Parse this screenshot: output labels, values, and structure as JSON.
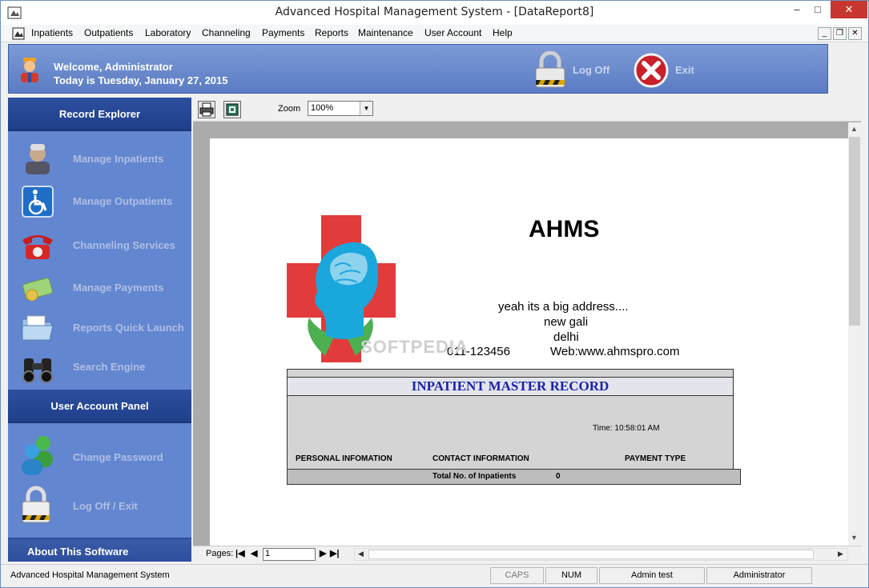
{
  "window": {
    "title": "Advanced Hospital Management System - [DataReport8]",
    "minimize": "–",
    "maximize": "□",
    "close": "✕",
    "mdi_minimize": "_",
    "mdi_restore": "❐",
    "mdi_close": "✕"
  },
  "menu": [
    "Inpatients",
    "Outpatients",
    "Laboratory",
    "Channeling",
    "Payments",
    "Reports",
    "Maintenance",
    "User Account",
    "Help"
  ],
  "header": {
    "welcome": "Welcome, Administrator",
    "date": "Today is Tuesday, January 27, 2015",
    "logoff": "Log Off",
    "exit": "Exit"
  },
  "sidebar": {
    "record_header": "Record Explorer",
    "items": [
      {
        "label": "Manage Inpatients",
        "icon": "nurse-icon"
      },
      {
        "label": "Manage Outpatients",
        "icon": "wheelchair-icon"
      },
      {
        "label": "Channeling Services",
        "icon": "telephone-icon"
      },
      {
        "label": "Manage Payments",
        "icon": "money-icon"
      },
      {
        "label": "Reports Quick Launch",
        "icon": "folder-icon"
      },
      {
        "label": "Search Engine",
        "icon": "binoculars-icon"
      }
    ],
    "account_header": "User Account Panel",
    "account_items": [
      {
        "label": "Change Password",
        "icon": "users-icon"
      },
      {
        "label": "Log Off / Exit",
        "icon": "padlock-icon"
      }
    ],
    "about": "About This Software"
  },
  "report_toolbar": {
    "zoom_label": "Zoom",
    "zoom_value": "100%",
    "pages_label": "Pages:",
    "page_value": "1"
  },
  "report": {
    "title": "AHMS",
    "address1": "yeah its a big address....",
    "address2": "new gali",
    "address3": "delhi",
    "phone": "011-123456",
    "web": "Web:www.ahmspro.com",
    "watermark": "SOFTPEDIA",
    "record_title": "INPATIENT MASTER RECORD",
    "time": "Time: 10:58:01 AM",
    "col1": "PERSONAL INFOMATION",
    "col2": "CONTACT INFORMATION",
    "col3": "PAYMENT TYPE",
    "total_label": "Total No. of Inpatients",
    "total_value": "0"
  },
  "statusbar": {
    "app": "Advanced Hospital Management System",
    "caps": "CAPS",
    "num": "NUM",
    "machine": "Admin test",
    "user": "Administrator"
  },
  "colors": {
    "panel_blue": "#6386d0",
    "header_blue": "#2c4f9e",
    "record_title": "#1a23a8",
    "cross_red": "#e23b3b",
    "head_cyan": "#1aa7dc"
  }
}
